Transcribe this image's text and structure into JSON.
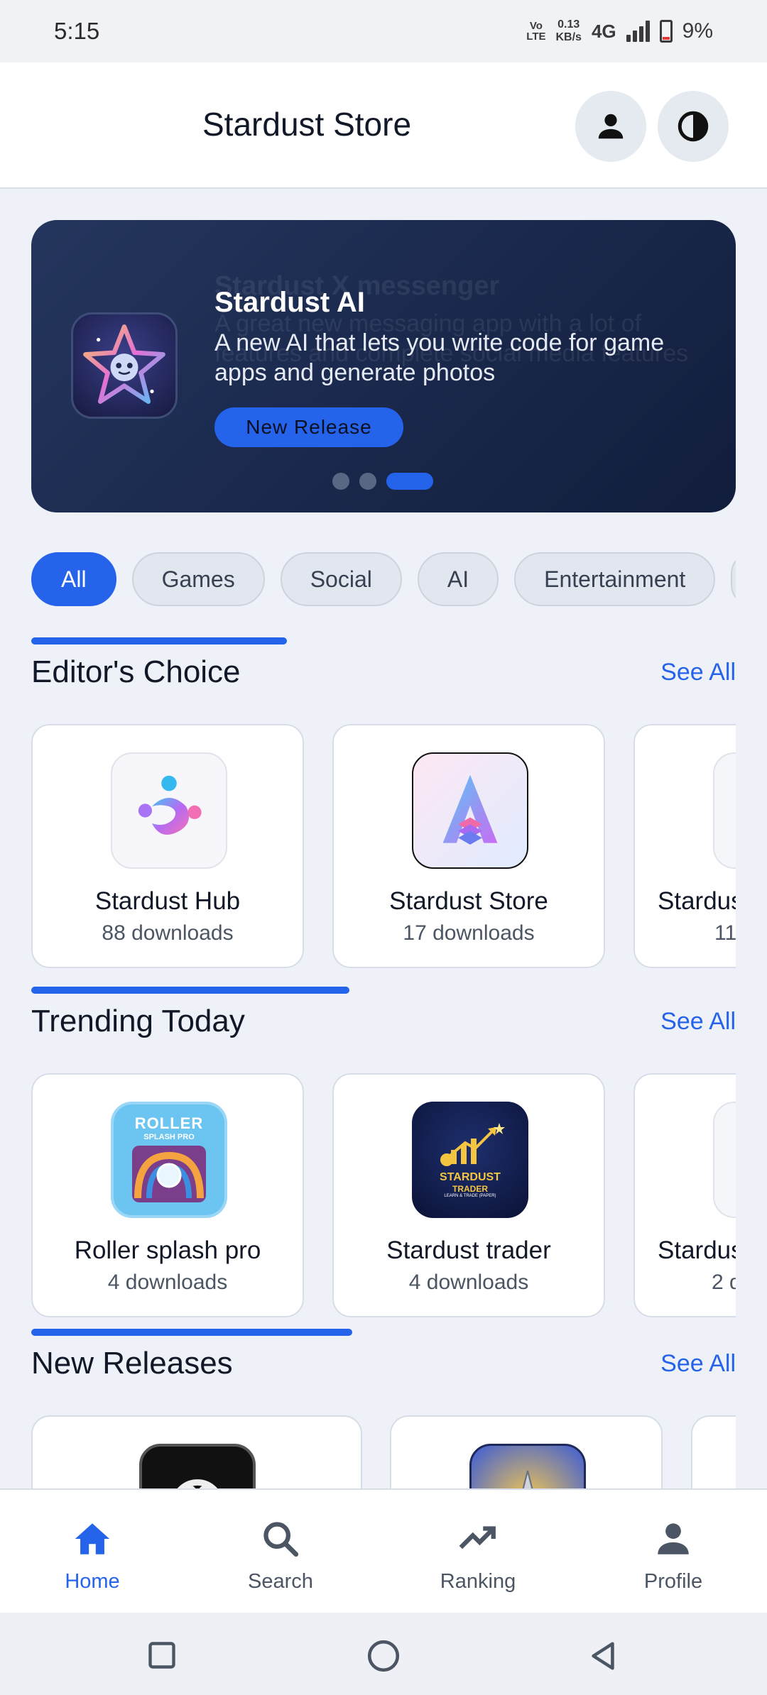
{
  "status_bar": {
    "time": "5:15",
    "volte": "Vo LTE",
    "net_speed_value": "0.13",
    "net_speed_unit": "KB/s",
    "network": "4G",
    "battery": "9%"
  },
  "header": {
    "title": "Stardust Store"
  },
  "banner": {
    "ghost_title": "Stardust X messenger",
    "ghost_description": "A great new messaging app with a lot of features and complete social media features",
    "title": "Stardust AI",
    "description": "A new AI that lets you write code for game apps and generate photos",
    "button_label": "New Release",
    "slide_count": 3,
    "active_slide": 3
  },
  "categories": [
    "All",
    "Games",
    "Social",
    "AI",
    "Entertainment"
  ],
  "active_category": "All",
  "sections": {
    "editors_choice": {
      "title": "Editor's Choice",
      "see_all": "See All",
      "apps": [
        {
          "name": "Stardust Hub",
          "downloads": "88 downloads"
        },
        {
          "name": "Stardust Store",
          "downloads": "17 downloads"
        },
        {
          "name": "Stardus",
          "downloads": "11"
        }
      ]
    },
    "trending": {
      "title": "Trending Today",
      "see_all": "See All",
      "apps": [
        {
          "name": "Roller splash pro",
          "downloads": "4 downloads",
          "icon_text_1": "ROLLER",
          "icon_text_2": "SPLASH PRO"
        },
        {
          "name": "Stardust trader",
          "downloads": "4 downloads",
          "icon_text_1": "STARDUST",
          "icon_text_2": "TRADER",
          "icon_text_3": "LEARN & TRADE (PAPER)"
        },
        {
          "name": "Stardus",
          "downloads": "2 d"
        }
      ]
    },
    "new_releases": {
      "title": "New Releases",
      "see_all": "See All"
    }
  },
  "bottom_nav": {
    "items": [
      {
        "label": "Home",
        "icon": "home-icon"
      },
      {
        "label": "Search",
        "icon": "search-icon"
      },
      {
        "label": "Ranking",
        "icon": "trending-icon"
      },
      {
        "label": "Profile",
        "icon": "person-icon"
      }
    ],
    "active": "Home"
  },
  "colors": {
    "accent": "#2563eb",
    "banner_bg": "#1b2a4e",
    "page_bg": "#eef1f7"
  }
}
